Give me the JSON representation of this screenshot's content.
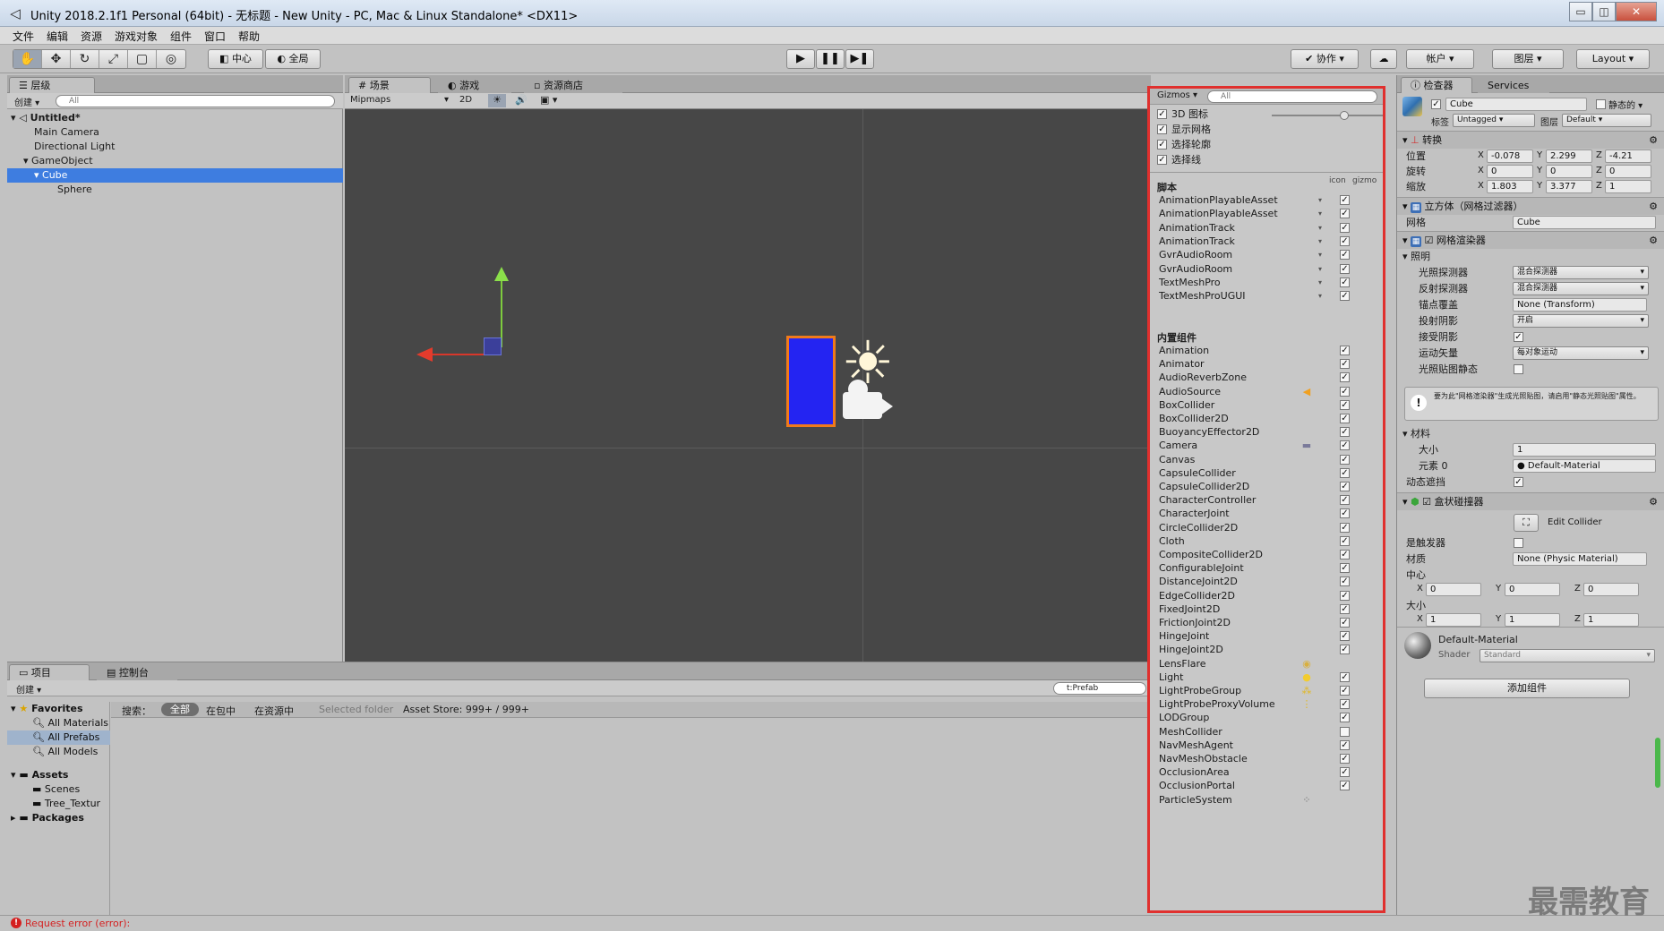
{
  "window": {
    "title": "Unity 2018.2.1f1 Personal (64bit) - 无标题 - New Unity - PC, Mac & Linux Standalone* <DX11>",
    "minimize": "▭",
    "maximize": "◫",
    "close": "✕"
  },
  "menu": [
    "文件",
    "编辑",
    "资源",
    "游戏对象",
    "组件",
    "窗口",
    "帮助"
  ],
  "toolbar": {
    "pivot_label": "中心",
    "space_label": "全局",
    "collab_label": "协作",
    "account_label": "帐户",
    "layers_label": "图层",
    "layout_label": "Layout"
  },
  "hierarchy": {
    "tab": "层级",
    "create_label": "创建",
    "search_placeholder": "All",
    "scene_name": "Untitled*",
    "items": [
      "Main Camera",
      "Directional Light",
      "GameObject",
      "Cube",
      "Sphere"
    ]
  },
  "scene": {
    "tabs": [
      "场景",
      "游戏",
      "资源商店"
    ],
    "shading_mode": "Mipmaps",
    "mode_2d": "2D",
    "gizmos_label": "Gizmos",
    "search_placeholder": "All"
  },
  "gizmos": {
    "options": [
      {
        "label": "3D 图标",
        "checked": true
      },
      {
        "label": "显示网格",
        "checked": true
      },
      {
        "label": "选择轮廓",
        "checked": true
      },
      {
        "label": "选择线",
        "checked": true
      }
    ],
    "scripts_header": "脚本",
    "col_icon": "icon",
    "col_gizmo": "gizmo",
    "scripts": [
      "AnimationPlayableAsset",
      "AnimationPlayableAsset",
      "AnimationTrack",
      "AnimationTrack",
      "GvrAudioRoom",
      "GvrAudioRoom",
      "TextMeshPro",
      "TextMeshProUGUI"
    ],
    "builtin_header": "内置组件",
    "builtin": [
      {
        "label": "Animation",
        "checked": true,
        "icon": ""
      },
      {
        "label": "Animator",
        "checked": true,
        "icon": ""
      },
      {
        "label": "AudioReverbZone",
        "checked": true,
        "icon": ""
      },
      {
        "label": "AudioSource",
        "checked": true,
        "icon": "speaker-icon"
      },
      {
        "label": "BoxCollider",
        "checked": true,
        "icon": ""
      },
      {
        "label": "BoxCollider2D",
        "checked": true,
        "icon": ""
      },
      {
        "label": "BuoyancyEffector2D",
        "checked": true,
        "icon": ""
      },
      {
        "label": "Camera",
        "checked": true,
        "icon": "camera-icon"
      },
      {
        "label": "Canvas",
        "checked": true,
        "icon": ""
      },
      {
        "label": "CapsuleCollider",
        "checked": true,
        "icon": ""
      },
      {
        "label": "CapsuleCollider2D",
        "checked": true,
        "icon": ""
      },
      {
        "label": "CharacterController",
        "checked": true,
        "icon": ""
      },
      {
        "label": "CharacterJoint",
        "checked": true,
        "icon": ""
      },
      {
        "label": "CircleCollider2D",
        "checked": true,
        "icon": ""
      },
      {
        "label": "Cloth",
        "checked": true,
        "icon": ""
      },
      {
        "label": "CompositeCollider2D",
        "checked": true,
        "icon": ""
      },
      {
        "label": "ConfigurableJoint",
        "checked": true,
        "icon": ""
      },
      {
        "label": "DistanceJoint2D",
        "checked": true,
        "icon": ""
      },
      {
        "label": "EdgeCollider2D",
        "checked": true,
        "icon": ""
      },
      {
        "label": "FixedJoint2D",
        "checked": true,
        "icon": ""
      },
      {
        "label": "FrictionJoint2D",
        "checked": true,
        "icon": ""
      },
      {
        "label": "HingeJoint",
        "checked": true,
        "icon": ""
      },
      {
        "label": "HingeJoint2D",
        "checked": true,
        "icon": ""
      },
      {
        "label": "LensFlare",
        "checked": null,
        "icon": "lensflare-icon"
      },
      {
        "label": "Light",
        "checked": true,
        "icon": "bulb-icon"
      },
      {
        "label": "LightProbeGroup",
        "checked": true,
        "icon": "lightprobe-icon"
      },
      {
        "label": "LightProbeProxyVolume",
        "checked": true,
        "icon": "probevolume-icon"
      },
      {
        "label": "LODGroup",
        "checked": true,
        "icon": ""
      },
      {
        "label": "MeshCollider",
        "checked": false,
        "icon": ""
      },
      {
        "label": "NavMeshAgent",
        "checked": true,
        "icon": ""
      },
      {
        "label": "NavMeshObstacle",
        "checked": true,
        "icon": ""
      },
      {
        "label": "OcclusionArea",
        "checked": true,
        "icon": ""
      },
      {
        "label": "OcclusionPortal",
        "checked": true,
        "icon": ""
      },
      {
        "label": "ParticleSystem",
        "checked": null,
        "icon": "particles-icon"
      }
    ]
  },
  "inspector": {
    "tabs": [
      "检查器",
      "Services"
    ],
    "object_name": "Cube",
    "static_label": "静态的",
    "tag_label": "标签",
    "tag_value": "Untagged",
    "layer_label": "图层",
    "layer_value": "Default",
    "transform": {
      "title": "转换",
      "position_label": "位置",
      "position": [
        "-0.078",
        "2.299",
        "-4.21"
      ],
      "rotation_label": "旋转",
      "rotation": [
        "0",
        "0",
        "0"
      ],
      "scale_label": "缩放",
      "scale": [
        "1.803",
        "3.377",
        "1"
      ]
    },
    "mesh_filter": {
      "title": "立方体（网格过滤器）",
      "mesh_label": "网格",
      "mesh_value": "Cube"
    },
    "mesh_renderer": {
      "title": "网格渲染器",
      "lighting_label": "照明",
      "rows": [
        {
          "label": "光照探测器",
          "value": "混合探测器",
          "kind": "dropdown"
        },
        {
          "label": "反射探测器",
          "value": "混合探测器",
          "kind": "dropdown"
        },
        {
          "label": "锚点覆盖",
          "value": "None (Transform)",
          "kind": "field"
        },
        {
          "label": "投射阴影",
          "value": "开启",
          "kind": "dropdown"
        },
        {
          "label": "接受阴影",
          "value": "",
          "kind": "check-on"
        },
        {
          "label": "运动矢量",
          "value": "每对象运动",
          "kind": "dropdown"
        },
        {
          "label": "光照贴图静态",
          "value": "",
          "kind": "check-off"
        }
      ],
      "info": "要为此\"网格渲染器\"生成光照贴图，请启用\"静态光照贴图\"属性。",
      "materials_label": "材料",
      "size_label": "大小",
      "size_value": "1",
      "element_label": "元素 0",
      "element_value": "Default-Material",
      "dynamic_occluded_label": "动态遮挡"
    },
    "box_collider": {
      "title": "盒状碰撞器",
      "edit_label": "Edit Collider",
      "trigger_label": "是触发器",
      "material_label": "材质",
      "material_value": "None (Physic Material)",
      "center_label": "中心",
      "center": [
        "0",
        "0",
        "0"
      ],
      "size_label": "大小",
      "size": [
        "1",
        "1",
        "1"
      ]
    },
    "material": {
      "name": "Default-Material",
      "shader_label": "Shader",
      "shader_value": "Standard"
    },
    "add_component_label": "添加组件",
    "axes": [
      "X",
      "Y",
      "Z"
    ]
  },
  "project": {
    "tabs": [
      "项目",
      "控制台"
    ],
    "create_label": "创建",
    "search_value": "t:Prefab",
    "favorites_label": "Favorites",
    "favorites": [
      "All Materials",
      "All Prefabs",
      "All Models"
    ],
    "assets_label": "Assets",
    "assets": [
      "Scenes",
      "Tree_Textur"
    ],
    "packages_label": "Packages",
    "search_label": "搜索：",
    "filters": [
      "全部",
      "在包中",
      "在资源中"
    ],
    "selected_folder": "Selected folder",
    "asset_store": "Asset Store: 999+ / 999+"
  },
  "status": {
    "message": "Request error (error):"
  },
  "watermark": "最需教育",
  "colors": {
    "accent": "#3e7de0",
    "highlight_border": "#e0302e",
    "error": "#d42020"
  }
}
